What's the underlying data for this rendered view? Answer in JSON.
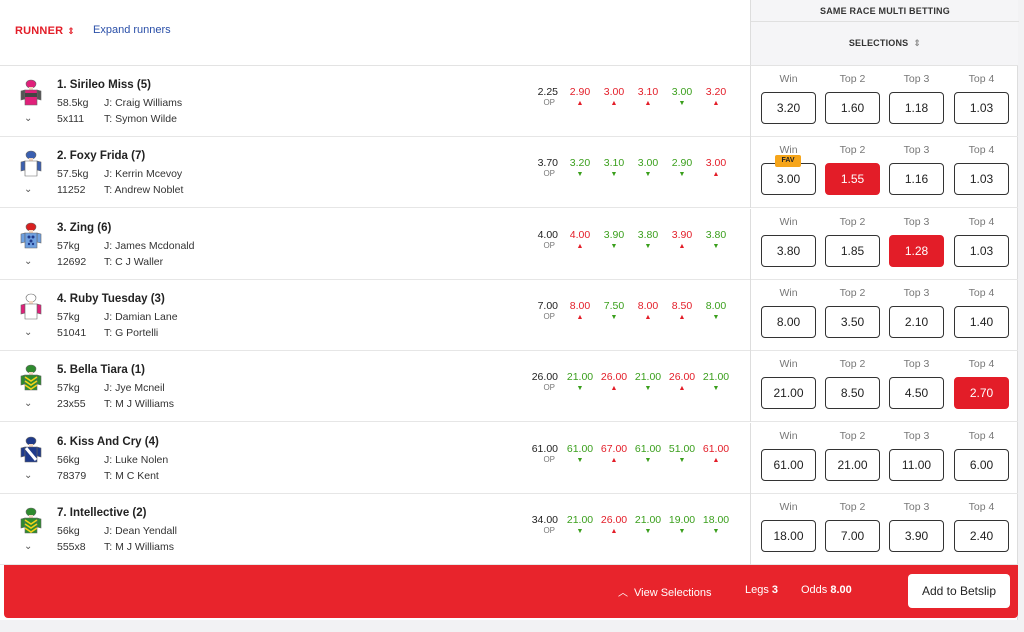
{
  "header": {
    "runner_label": "RUNNER",
    "sort_icon": "⇕",
    "expand_label": "Expand runners",
    "srm_title": "SAME RACE MULTI BETTING",
    "selections_label": "SELECTIONS"
  },
  "columns": [
    "Win",
    "Top 2",
    "Top 3",
    "Top 4"
  ],
  "fav_label": "FAV",
  "op_label": "OP",
  "colors": {
    "accent": "#e31d28",
    "up": "#e31d28",
    "down": "#3a9f1c",
    "fav": "#f6a51a"
  },
  "runners": [
    {
      "name": "1. Sirileo Miss (5)",
      "weight": "58.5kg",
      "jockey": "J: Craig Williams",
      "form": "5x111",
      "trainer": "T: Symon Wilde",
      "op": "2.25",
      "fluct": [
        [
          "2.90",
          "up"
        ],
        [
          "3.00",
          "up"
        ],
        [
          "3.10",
          "up"
        ],
        [
          "3.00",
          "dn"
        ],
        [
          "3.20",
          "up"
        ]
      ],
      "odds": [
        "3.20",
        "1.60",
        "1.18",
        "1.03"
      ],
      "selected": -1,
      "fav": false,
      "silk": {
        "cap": "#e0207a",
        "body": "#e0207a",
        "sleeve": "#555",
        "pattern": "band"
      }
    },
    {
      "name": "2. Foxy Frida (7)",
      "weight": "57.5kg",
      "jockey": "J: Kerrin Mcevoy",
      "form": "11252",
      "trainer": "T: Andrew Noblet",
      "op": "3.70",
      "fluct": [
        [
          "3.20",
          "dn"
        ],
        [
          "3.10",
          "dn"
        ],
        [
          "3.00",
          "dn"
        ],
        [
          "2.90",
          "dn"
        ],
        [
          "3.00",
          "up"
        ]
      ],
      "odds": [
        "3.00",
        "1.55",
        "1.16",
        "1.03"
      ],
      "selected": 1,
      "fav": true,
      "silk": {
        "cap": "#3a5fb0",
        "body": "#ffffff",
        "sleeve": "#3a5fb0",
        "pattern": "plain"
      }
    },
    {
      "name": "3. Zing (6)",
      "weight": "57kg",
      "jockey": "J: James Mcdonald",
      "form": "12692",
      "trainer": "T: C J Waller",
      "op": "4.00",
      "fluct": [
        [
          "4.00",
          "up"
        ],
        [
          "3.90",
          "dn"
        ],
        [
          "3.80",
          "dn"
        ],
        [
          "3.90",
          "up"
        ],
        [
          "3.80",
          "dn"
        ]
      ],
      "odds": [
        "3.80",
        "1.85",
        "1.28",
        "1.03"
      ],
      "selected": 2,
      "fav": false,
      "silk": {
        "cap": "#d92020",
        "body": "#6fa0e0",
        "sleeve": "#6fa0e0",
        "pattern": "dots"
      }
    },
    {
      "name": "4. Ruby Tuesday (3)",
      "weight": "57kg",
      "jockey": "J: Damian Lane",
      "form": "51041",
      "trainer": "T: G Portelli",
      "op": "7.00",
      "fluct": [
        [
          "8.00",
          "up"
        ],
        [
          "7.50",
          "dn"
        ],
        [
          "8.00",
          "up"
        ],
        [
          "8.50",
          "up"
        ],
        [
          "8.00",
          "dn"
        ]
      ],
      "odds": [
        "8.00",
        "3.50",
        "2.10",
        "1.40"
      ],
      "selected": -1,
      "fav": false,
      "silk": {
        "cap": "#ffffff",
        "body": "#ffffff",
        "sleeve": "#e0207a",
        "pattern": "plain"
      }
    },
    {
      "name": "5. Bella Tiara (1)",
      "weight": "57kg",
      "jockey": "J: Jye Mcneil",
      "form": "23x55",
      "trainer": "T: M J Williams",
      "op": "26.00",
      "fluct": [
        [
          "21.00",
          "dn"
        ],
        [
          "26.00",
          "up"
        ],
        [
          "21.00",
          "dn"
        ],
        [
          "26.00",
          "up"
        ],
        [
          "21.00",
          "dn"
        ]
      ],
      "odds": [
        "21.00",
        "8.50",
        "4.50",
        "2.70"
      ],
      "selected": 3,
      "fav": false,
      "silk": {
        "cap": "#2e8b2e",
        "body": "#2e8b2e",
        "sleeve": "#2e8b2e",
        "pattern": "chevron"
      }
    },
    {
      "name": "6. Kiss And Cry (4)",
      "weight": "56kg",
      "jockey": "J: Luke Nolen",
      "form": "78379",
      "trainer": "T: M C Kent",
      "op": "61.00",
      "fluct": [
        [
          "61.00",
          "dn"
        ],
        [
          "67.00",
          "up"
        ],
        [
          "61.00",
          "dn"
        ],
        [
          "51.00",
          "dn"
        ],
        [
          "61.00",
          "up"
        ]
      ],
      "odds": [
        "61.00",
        "21.00",
        "11.00",
        "6.00"
      ],
      "selected": -1,
      "fav": false,
      "silk": {
        "cap": "#1f3a8a",
        "body": "#1f3a8a",
        "sleeve": "#1f3a8a",
        "pattern": "sash"
      }
    },
    {
      "name": "7. Intellective (2)",
      "weight": "56kg",
      "jockey": "J: Dean Yendall",
      "form": "555x8",
      "trainer": "T: M J Williams",
      "op": "34.00",
      "fluct": [
        [
          "21.00",
          "dn"
        ],
        [
          "26.00",
          "up"
        ],
        [
          "21.00",
          "dn"
        ],
        [
          "19.00",
          "dn"
        ],
        [
          "18.00",
          "dn"
        ]
      ],
      "odds": [
        "18.00",
        "7.00",
        "3.90",
        "2.40"
      ],
      "selected": -1,
      "fav": false,
      "silk": {
        "cap": "#2e8b2e",
        "body": "#2e8b2e",
        "sleeve": "#2e8b2e",
        "pattern": "chevron"
      }
    }
  ],
  "footer": {
    "view_label": "View Selections",
    "legs_label": "Legs",
    "legs_value": "3",
    "odds_label": "Odds",
    "odds_value": "8.00",
    "add_label": "Add to Betslip"
  }
}
